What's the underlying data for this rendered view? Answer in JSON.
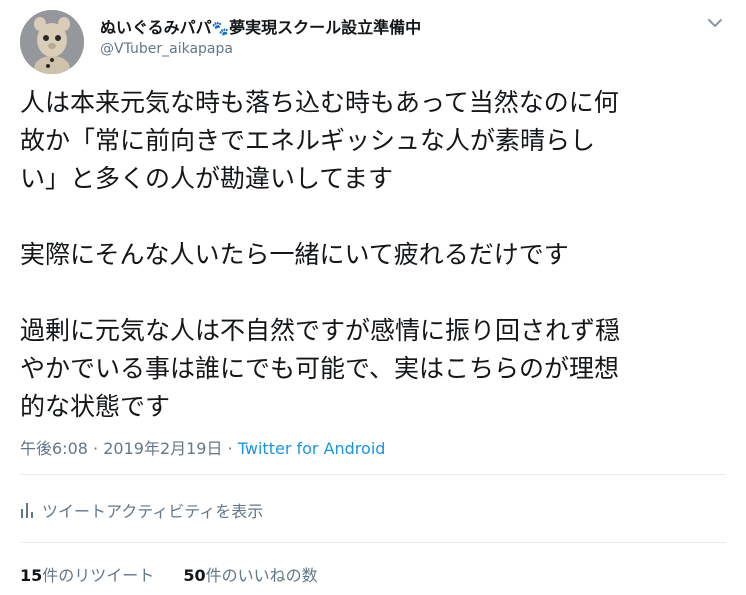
{
  "user": {
    "display_name": "ぬいぐるみパパ",
    "paw": "🐾",
    "display_suffix": "夢実現スクール設立準備中",
    "handle": "@VTuber_aikapapa"
  },
  "tweet": {
    "lines": [
      "人は本来元気な時も落ち込む時もあって当然なのに何",
      "故か「常に前向きでエネルギッシュな人が素晴らし",
      "い」と多くの人が勘違いしてます",
      "",
      "実際にそんな人いたら一緒にいて疲れるだけです",
      "",
      "過剰に元気な人は不自然ですが感情に振り回されず穏",
      "やかでいる事は誰にでも可能で、実はこちらのが理想",
      "的な状態です"
    ],
    "time": "午後6:08",
    "separator": "·",
    "date": "2019年2月19日",
    "client": "Twitter for Android"
  },
  "activity": {
    "label": "ツイートアクティビティを表示"
  },
  "stats": {
    "retweets_count": "15",
    "retweets_label": "件のリツイート",
    "likes_count": "50",
    "likes_label": "件のいいねの数"
  },
  "colors": {
    "text": "#14171a",
    "secondary": "#657786",
    "link": "#1b95e0",
    "divider": "#e6ecf0"
  }
}
